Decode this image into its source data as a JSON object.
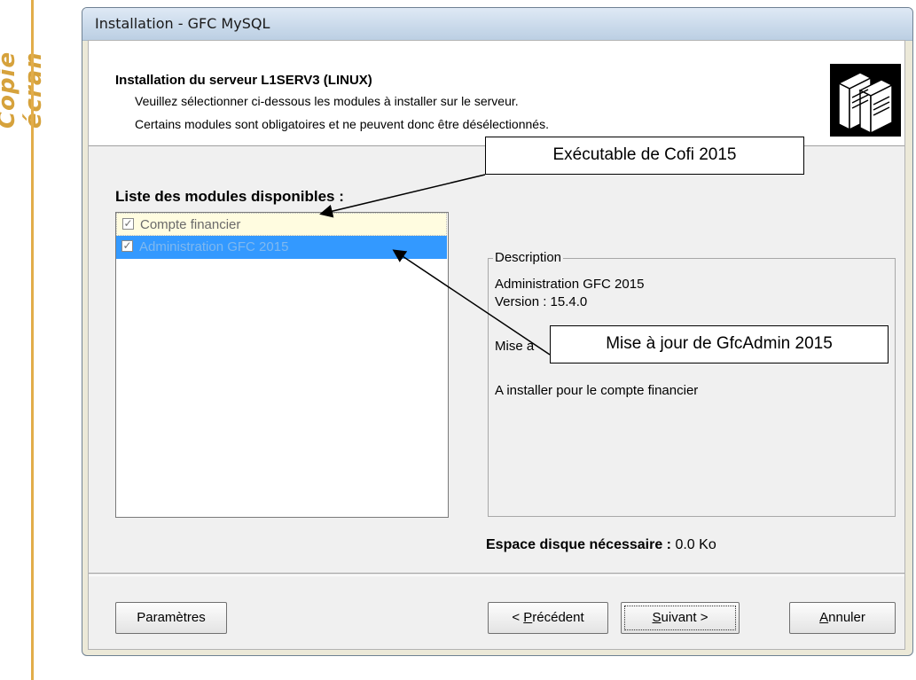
{
  "side_label": "Copie écran",
  "window": {
    "title": "Installation - GFC MySQL"
  },
  "header": {
    "title": "Installation du serveur L1SERV3 (LINUX)",
    "line1": "Veuillez sélectionner ci-dessous les modules à installer sur le serveur.",
    "line2": "Certains modules sont obligatoires et ne peuvent donc être désélectionnés.",
    "icon": "server-icon"
  },
  "modules": {
    "title": "Liste des modules disponibles :",
    "items": [
      {
        "label": "Compte financier",
        "checked": true
      },
      {
        "label": "Administration GFC 2015",
        "checked": true,
        "selected": true
      }
    ]
  },
  "description": {
    "legend": "Description",
    "name": "Administration GFC 2015",
    "version": "Version : 15.4.0",
    "update": "Mise à",
    "note": "A installer pour le compte financier"
  },
  "disk": {
    "label": "Espace disque nécessaire :",
    "value": "0.0 Ko"
  },
  "buttons": {
    "params": "Paramètres",
    "prev_prefix": "< ",
    "prev_accel": "P",
    "prev_rest": "récédent",
    "next_accel": "S",
    "next_rest": "uivant >",
    "cancel_accel": "A",
    "cancel_rest": "nnuler"
  },
  "callouts": {
    "exe": "Exécutable de Cofi 2015",
    "update": "Mise à jour de GfcAdmin 2015"
  }
}
